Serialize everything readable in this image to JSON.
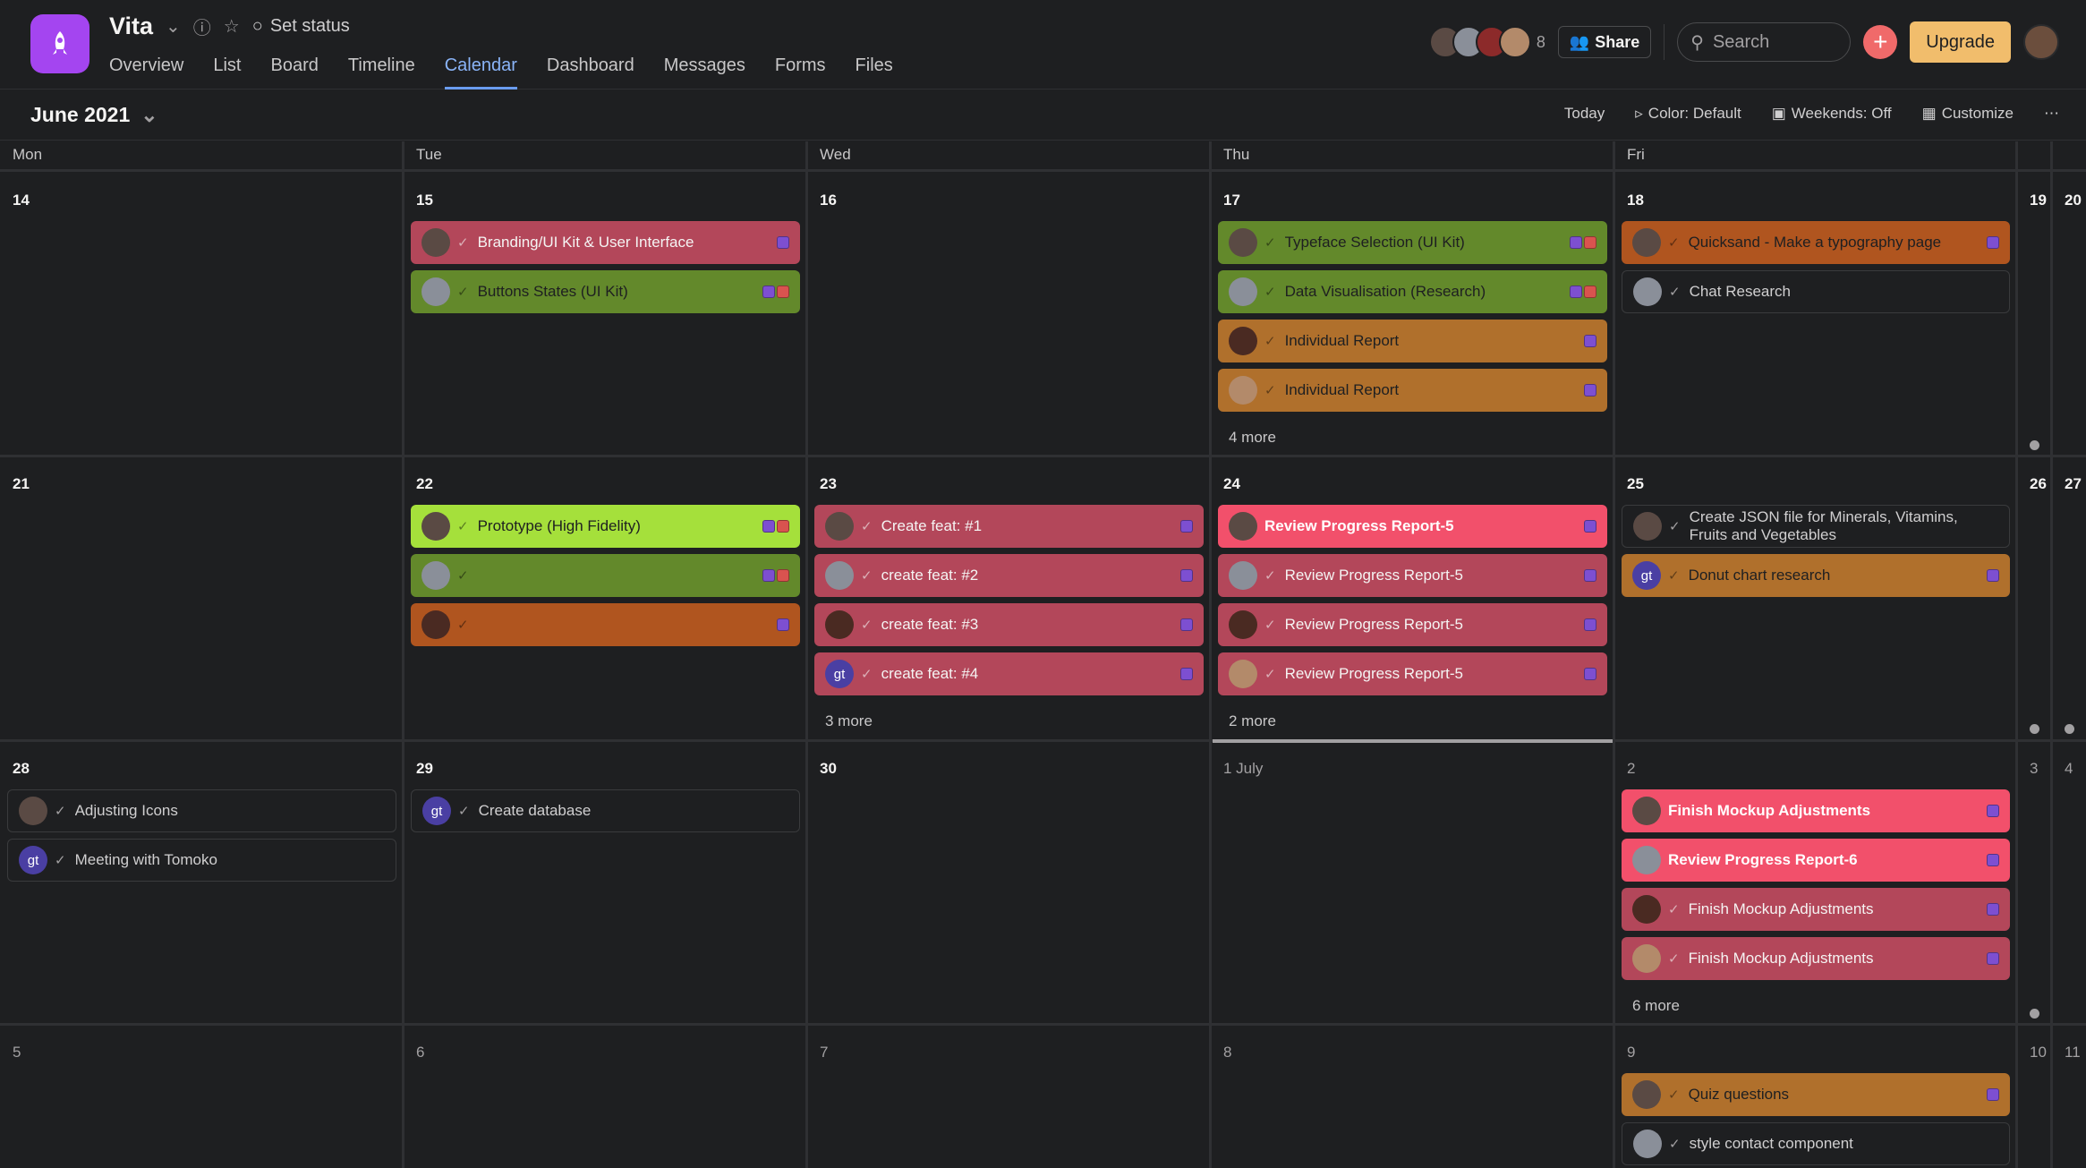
{
  "project": {
    "name": "Vita",
    "set_status": "Set status"
  },
  "tabs": [
    "Overview",
    "List",
    "Board",
    "Timeline",
    "Calendar",
    "Dashboard",
    "Messages",
    "Forms",
    "Files"
  ],
  "active_tab": "Calendar",
  "header": {
    "member_count": "8",
    "share": "Share",
    "search_placeholder": "Search",
    "upgrade": "Upgrade"
  },
  "toolbar": {
    "month": "June 2021",
    "today": "Today",
    "color": "Color: Default",
    "weekends": "Weekends: Off",
    "customize": "Customize"
  },
  "day_headers": [
    "Mon",
    "Tue",
    "Wed",
    "Thu",
    "Fri"
  ],
  "weeks": [
    {
      "dates": [
        "14",
        "15",
        "16",
        "17",
        "18",
        "19",
        "20"
      ]
    },
    {
      "dates": [
        "21",
        "22",
        "23",
        "24",
        "25",
        "26",
        "27"
      ]
    },
    {
      "dates": [
        "28",
        "29",
        "30",
        "1 July",
        "2",
        "3",
        "4"
      ]
    },
    {
      "dates": [
        "5",
        "6",
        "7",
        "8",
        "9",
        "10",
        "11"
      ]
    }
  ],
  "tasks": {
    "w0_tue": [
      {
        "label": "Branding/UI Kit & User Interface",
        "color": "red",
        "tags": [
          "#7d4fd1"
        ]
      },
      {
        "label": "Buttons States (UI Kit)",
        "color": "green",
        "tags": [
          "#7d4fd1",
          "#d9534f"
        ]
      }
    ],
    "w0_thu": [
      {
        "label": "Typeface Selection (UI Kit)",
        "color": "green",
        "tags": [
          "#7d4fd1",
          "#d9534f"
        ]
      },
      {
        "label": "Data Visualisation (Research)",
        "color": "green",
        "tags": [
          "#7d4fd1",
          "#d9534f"
        ]
      },
      {
        "label": "Individual Report",
        "color": "orange",
        "tags": [
          "#7d4fd1"
        ]
      },
      {
        "label": "Individual Report",
        "color": "orange",
        "tags": [
          "#7d4fd1"
        ]
      }
    ],
    "w0_thu_more": "4 more",
    "w0_fri": [
      {
        "label": "Quicksand - Make a typography page",
        "color": "rust",
        "tags": [
          "#7d4fd1"
        ]
      },
      {
        "label": "Chat Research",
        "color": "dark",
        "tags": []
      }
    ],
    "w1_tue": [
      {
        "label": "Prototype (High Fidelity)",
        "color": "lime",
        "tags": [
          "#7d4fd1",
          "#d9534f"
        ]
      },
      {
        "label": "",
        "color": "green",
        "tags": [
          "#7d4fd1",
          "#d9534f"
        ]
      },
      {
        "label": "",
        "color": "rust",
        "tags": [
          "#7d4fd1"
        ]
      }
    ],
    "w1_wed": [
      {
        "label": "Create feat: #1",
        "color": "red",
        "tags": [
          "#7d4fd1"
        ]
      },
      {
        "label": "create feat: #2",
        "color": "red",
        "tags": [
          "#7d4fd1"
        ]
      },
      {
        "label": "create feat: #3",
        "color": "red",
        "tags": [
          "#7d4fd1"
        ]
      },
      {
        "label": "create feat: #4",
        "color": "red",
        "tags": [
          "#7d4fd1"
        ],
        "initials": "gt"
      }
    ],
    "w1_wed_more": "3 more",
    "w1_thu": [
      {
        "label": "Review Progress Report-5",
        "color": "pink",
        "tags": [
          "#7d4fd1"
        ]
      },
      {
        "label": "Review Progress Report-5",
        "color": "red",
        "tags": [
          "#7d4fd1"
        ]
      },
      {
        "label": "Review Progress Report-5",
        "color": "red",
        "tags": [
          "#7d4fd1"
        ]
      },
      {
        "label": "Review Progress Report-5",
        "color": "red",
        "tags": [
          "#7d4fd1"
        ]
      }
    ],
    "w1_thu_more": "2 more",
    "w1_fri": [
      {
        "label": "Create JSON file for Minerals, Vitamins, Fruits and Vegetables",
        "color": "dark",
        "tags": []
      },
      {
        "label": "Donut chart research",
        "color": "orange",
        "tags": [
          "#7d4fd1"
        ],
        "initials": "gt"
      }
    ],
    "w2_mon": [
      {
        "label": "Adjusting Icons",
        "color": "dark",
        "tags": []
      },
      {
        "label": "Meeting with Tomoko",
        "color": "dark",
        "tags": [],
        "initials": "gt"
      }
    ],
    "w2_tue": [
      {
        "label": "Create database",
        "color": "dark",
        "tags": [],
        "initials": "gt"
      }
    ],
    "w2_fri": [
      {
        "label": "Finish Mockup Adjustments",
        "color": "pink",
        "tags": [
          "#7d4fd1"
        ]
      },
      {
        "label": "Review Progress Report-6",
        "color": "pink",
        "tags": [
          "#7d4fd1"
        ]
      },
      {
        "label": "Finish Mockup Adjustments",
        "color": "red",
        "tags": [
          "#7d4fd1"
        ]
      },
      {
        "label": "Finish Mockup Adjustments",
        "color": "red",
        "tags": [
          "#7d4fd1"
        ]
      }
    ],
    "w2_fri_more": "6 more",
    "w3_fri": [
      {
        "label": "Quiz questions",
        "color": "orange",
        "tags": [
          "#7d4fd1"
        ]
      },
      {
        "label": "style contact component",
        "color": "dark",
        "tags": []
      }
    ]
  }
}
